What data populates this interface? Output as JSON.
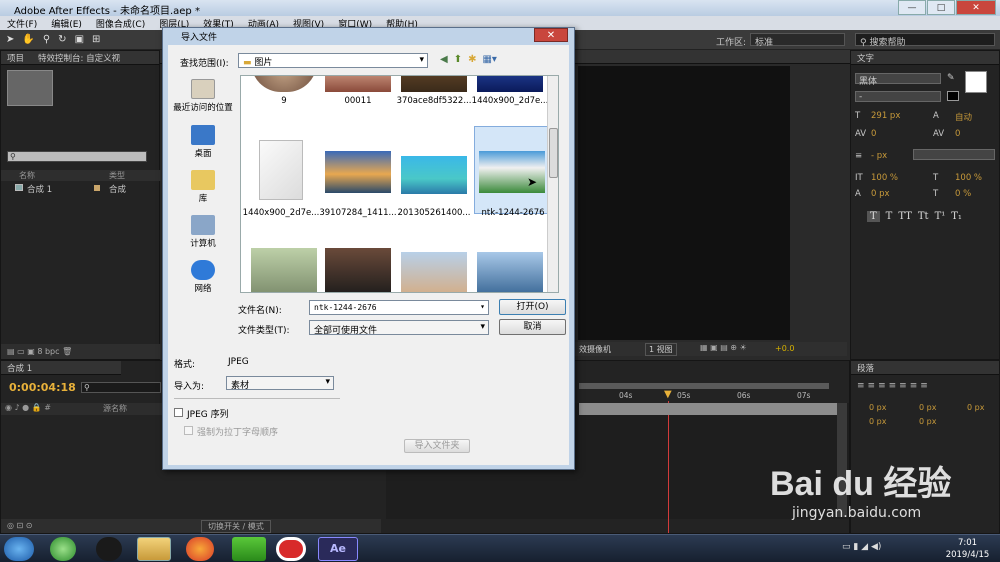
{
  "app": {
    "title": "Adobe After Effects - 未命名项目.aep *",
    "window_controls": [
      "—",
      "□",
      "✕"
    ]
  },
  "menu": [
    "文件(F)",
    "编辑(E)",
    "图像合成(C)",
    "图层(L)",
    "效果(T)",
    "动画(A)",
    "视图(V)",
    "窗口(W)",
    "帮助(H)"
  ],
  "toolbar": {
    "workspace_label": "工作区:",
    "workspace_value": "标准",
    "search_placeholder": "搜索帮助"
  },
  "project": {
    "tab": "项目",
    "effects_tab": "特效控制台: 自定义视",
    "col_name": "名称",
    "col_type": "类型",
    "item_name": "合成 1",
    "item_type": "合成",
    "bpc": "8 bpc"
  },
  "timeline": {
    "tab": "合成 1",
    "timecode": "0:00:04:18",
    "source_col": "源名称",
    "switch_label": "切换开关 / 模式",
    "ticks": [
      "04s",
      "05s",
      "06s",
      "07s"
    ]
  },
  "viewer": {
    "views": "1 视图",
    "camera": "效摄像机",
    "offset": "+0.0"
  },
  "char_panel": {
    "tab": "文字",
    "font": "黑体",
    "size": "291 px",
    "leading": "自动",
    "kerning": "0",
    "tracking": "0",
    "stroke": "- px",
    "vscale": "100 %",
    "hscale": "100 %",
    "baseline": "0 px",
    "tsume": "0 %",
    "styles": [
      "T",
      "T",
      "TT",
      "Tt",
      "T¹",
      "T₁"
    ]
  },
  "para_panel": {
    "tab": "段落",
    "indent_values": [
      "0 px",
      "0 px",
      "0 px",
      "0 px",
      "0 px"
    ]
  },
  "dialog": {
    "title": "导入文件",
    "close": "✕",
    "lookin_label": "查找范围(I):",
    "lookin_value": "图片",
    "places": [
      "最近访问的位置",
      "桌面",
      "库",
      "计算机",
      "网络"
    ],
    "files_top": [
      "9",
      "00011",
      "370ace8df5322...",
      "1440x900_2d7e..."
    ],
    "files_mid": [
      "1440x900_2d7e...",
      "39107284_1411...",
      "201305261400...",
      "ntk-1244-2676"
    ],
    "filename_label": "文件名(N):",
    "filename_value": "ntk-1244-2676",
    "filetype_label": "文件类型(T):",
    "filetype_value": "全部可使用文件",
    "open_button": "打开(O)",
    "cancel_button": "取消",
    "format_label": "格式:",
    "format_value": "JPEG",
    "importas_label": "导入为:",
    "importas_value": "素材",
    "jpeg_seq_label": "JPEG 序列",
    "alpha_order_label": "强制为拉丁字母顺序",
    "import_folder_button": "导入文件夹"
  },
  "tray": {
    "time": "7:01",
    "date": "2019/4/15"
  },
  "watermark": {
    "brand": "Bai du 经验",
    "url": "jingyan.baidu.com"
  }
}
